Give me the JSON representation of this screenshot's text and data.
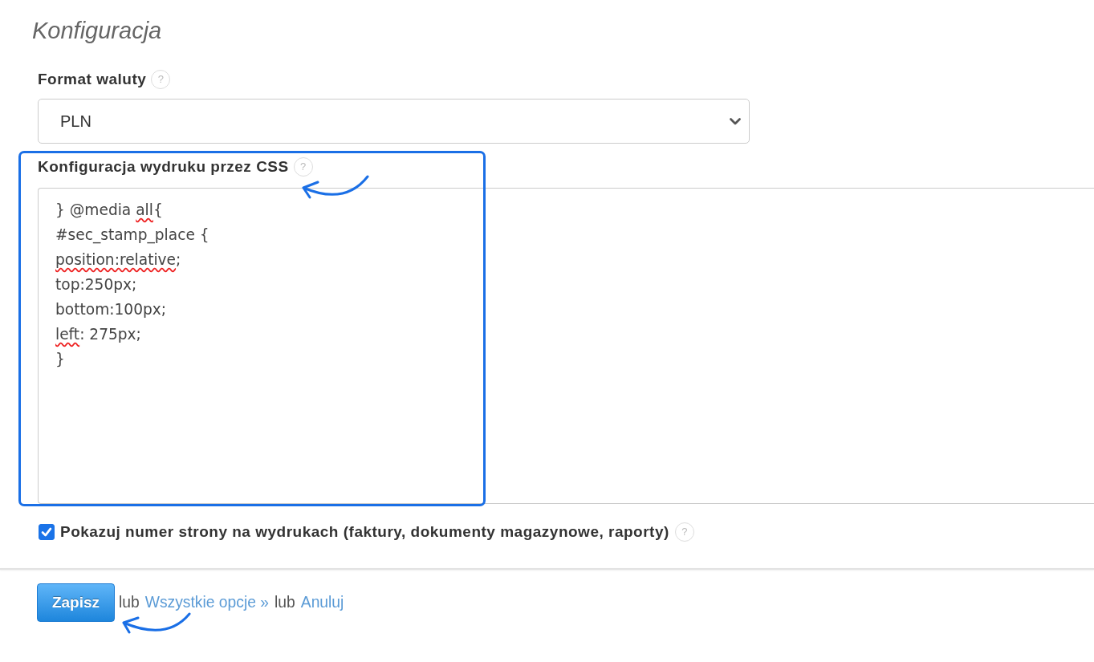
{
  "page": {
    "title": "Konfiguracja"
  },
  "currency_format": {
    "label": "Format waluty",
    "help": "?",
    "value": "PLN"
  },
  "css_print": {
    "label": "Konfiguracja wydruku przez CSS",
    "help": "?",
    "highlighted": true,
    "help_arrow": true,
    "lines": [
      [
        {
          "text": "} @media ",
          "misspelled": false
        },
        {
          "text": "all",
          "misspelled": true
        },
        {
          "text": "{",
          "misspelled": false
        }
      ],
      [
        {
          "text": "#sec_stamp_place {",
          "misspelled": false
        }
      ],
      [
        {
          "text": "position:relative",
          "misspelled": true
        },
        {
          "text": ";",
          "misspelled": false
        }
      ],
      [
        {
          "text": "top:250px;",
          "misspelled": false
        }
      ],
      [
        {
          "text": "bottom:100px;",
          "misspelled": false
        }
      ],
      [
        {
          "text": "left",
          "misspelled": true
        },
        {
          "text": ": 275px;",
          "misspelled": false
        }
      ],
      [
        {
          "text": "}",
          "misspelled": false
        }
      ]
    ]
  },
  "show_page_numbers": {
    "label": "Pokazuj numer strony na wydrukach (faktury, dokumenty magazynowe, raporty)",
    "help": "?",
    "checked": true
  },
  "actions": {
    "save": {
      "label": "Zapisz",
      "arrow": true
    },
    "items": [
      {
        "kind": "text",
        "text": "lub"
      },
      {
        "kind": "link",
        "text": "Wszystkie opcje »"
      },
      {
        "kind": "text",
        "text": "lub"
      },
      {
        "kind": "link",
        "text": "Anuluj"
      }
    ]
  }
}
